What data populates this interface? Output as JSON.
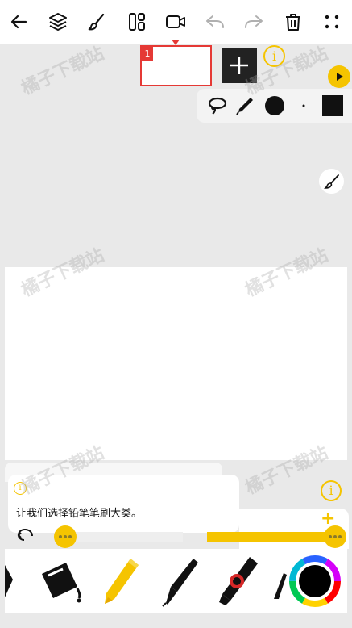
{
  "toolbar": {
    "items": [
      "back-icon",
      "layers-icon",
      "brush-icon",
      "frames-icon",
      "video-icon",
      "undo-icon",
      "redo-icon",
      "trash-icon",
      "more-icon"
    ]
  },
  "frames": {
    "current_number": "1"
  },
  "info_symbol": "i",
  "hint": {
    "text": "让我们选择铅笔笔刷大类。"
  },
  "watermark": "橘子下载站",
  "colors": {
    "accent": "#f5c400",
    "frame_border": "#e53935",
    "background": "#e9e9e9"
  }
}
